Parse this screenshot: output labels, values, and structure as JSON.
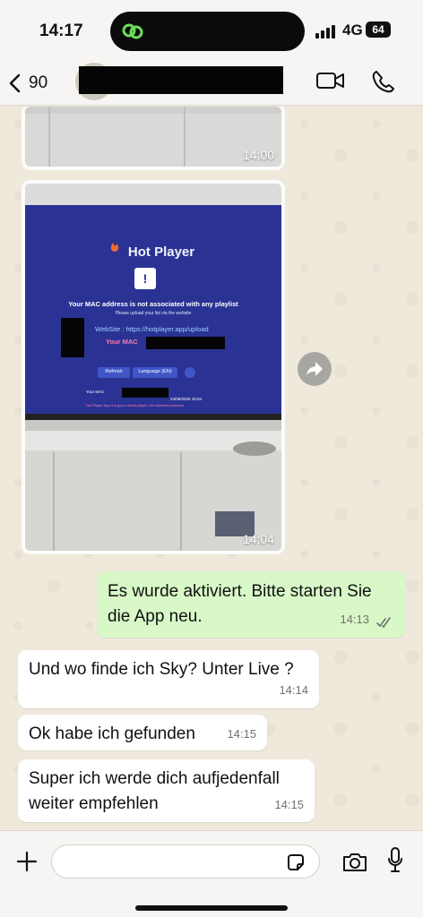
{
  "status": {
    "time": "14:17",
    "network": "4G",
    "battery": "64"
  },
  "header": {
    "back_count": "90",
    "icons": [
      "back-chevron-icon",
      "video-call-icon",
      "voice-call-icon"
    ]
  },
  "messages": {
    "media1_time": "14:00",
    "media2_time": "14:04",
    "tv": {
      "brand_pre": "Hot",
      "brand": "Player",
      "mac_heading": "Your MAC address is not associated with any playlist",
      "upload_line": "Please upload your list via the website",
      "website": "WebSite : https://hotplayer.app/upload",
      "your_mac": "Your MAC",
      "refresh": "Refresh",
      "language": "Language (EN)",
      "footer_mac": "Your MAC",
      "footer_date": "24/08/2025 15:04",
      "disclaimer": "Hot Player App It is just a media player, No channels included"
    },
    "out1": {
      "text": "Es wurde aktiviert. Bitte starten Sie die App neu.",
      "time": "14:13"
    },
    "in1": {
      "text": "Und wo finde ich Sky? Unter Live ?",
      "time": "14:14"
    },
    "in2": {
      "text": "Ok habe ich gefunden",
      "time": "14:15"
    },
    "in3": {
      "text": "Super ich werde dich aufjedenfall weiter empfehlen",
      "time": "14:15"
    }
  },
  "input": {
    "value": "",
    "icons": [
      "plus-icon",
      "sticker-icon",
      "camera-icon",
      "microphone-icon"
    ]
  },
  "colors": {
    "outgoing_bubble": "#d8f8c8",
    "incoming_bubble": "#ffffff",
    "tv_screen": "#2a3394"
  }
}
